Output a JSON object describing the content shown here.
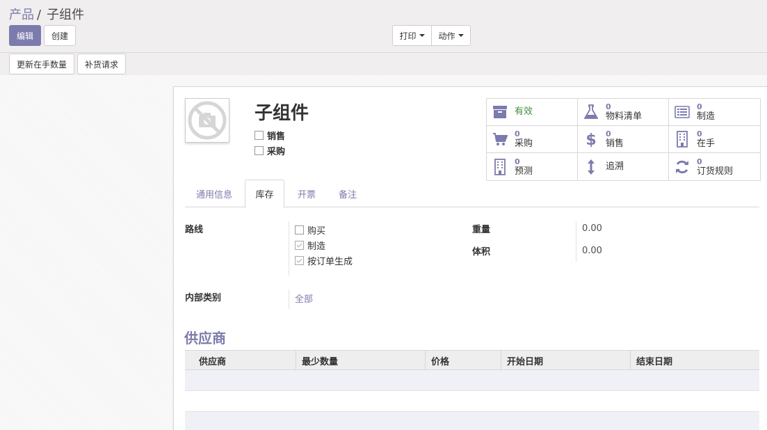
{
  "breadcrumb": {
    "parent": "产品",
    "separator": "/",
    "current": "子组件"
  },
  "control_panel": {
    "edit_label": "编辑",
    "create_label": "创建",
    "print_label": "打印",
    "action_label": "动作"
  },
  "header_buttons": {
    "update_qty_label": "更新在手数量",
    "replenish_label": "补货请求"
  },
  "product": {
    "name": "子组件",
    "image_icon": "camera-no-image-icon",
    "sale_ok": {
      "label": "销售",
      "checked": false
    },
    "purchase_ok": {
      "label": "采购",
      "checked": false
    }
  },
  "smart_buttons": [
    {
      "icon": "archive-icon",
      "value": "",
      "label": "有效"
    },
    {
      "icon": "flask-icon",
      "value": "0",
      "label": "物料清单"
    },
    {
      "icon": "list-icon",
      "value": "0",
      "label": "制造"
    },
    {
      "icon": "cart-icon",
      "value": "0",
      "label": "采购"
    },
    {
      "icon": "dollar-icon",
      "value": "0",
      "label": "销售"
    },
    {
      "icon": "building-icon",
      "value": "0",
      "label": "在手"
    },
    {
      "icon": "building-icon",
      "value": "0",
      "label": "预测"
    },
    {
      "icon": "updown-arrow-icon",
      "value": "",
      "label": "追溯"
    },
    {
      "icon": "refresh-icon",
      "value": "0",
      "label": "订货规则"
    }
  ],
  "tabs": [
    {
      "label": "通用信息",
      "active": false
    },
    {
      "label": "库存",
      "active": true
    },
    {
      "label": "开票",
      "active": false
    },
    {
      "label": "备注",
      "active": false
    }
  ],
  "inventory": {
    "routes_label": "路线",
    "routes": [
      {
        "label": "购买",
        "checked": false
      },
      {
        "label": "制造",
        "checked": true
      },
      {
        "label": "按订单生成",
        "checked": true
      }
    ],
    "weight_label": "重量",
    "weight_value": "0.00",
    "volume_label": "体积",
    "volume_value": "0.00",
    "category_label": "内部类别",
    "category_value": "全部"
  },
  "vendors": {
    "title": "供应商",
    "columns": [
      "供应商",
      "最少数量",
      "价格",
      "开始日期",
      "结束日期"
    ]
  },
  "colors": {
    "brand": "#7c7bad",
    "active_green": "#3e8f3e"
  }
}
